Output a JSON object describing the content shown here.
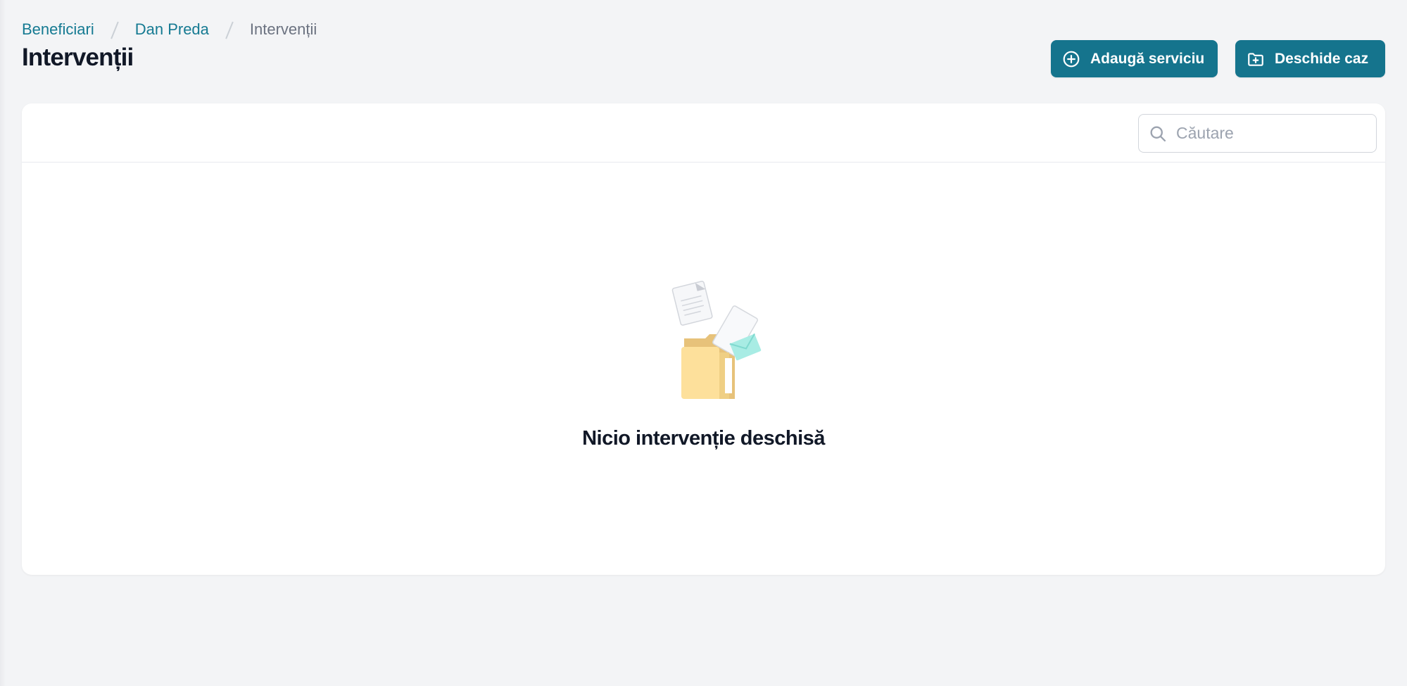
{
  "breadcrumb": {
    "items": [
      {
        "label": "Beneficiari"
      },
      {
        "label": "Dan Preda"
      },
      {
        "label": "Intervenții"
      }
    ]
  },
  "header": {
    "title": "Intervenții",
    "buttons": {
      "add_service": "Adaugă serviciu",
      "open_case": "Deschide caz"
    }
  },
  "search": {
    "placeholder": "Căutare",
    "value": ""
  },
  "empty_state": {
    "title": "Nicio intervenție deschisă"
  },
  "colors": {
    "accent": "#15748d",
    "link": "#157a92",
    "background": "#f3f4f6",
    "card": "#ffffff"
  },
  "icons": [
    "plus-circle-icon",
    "folder-plus-icon",
    "search-icon",
    "empty-folder-illustration"
  ]
}
